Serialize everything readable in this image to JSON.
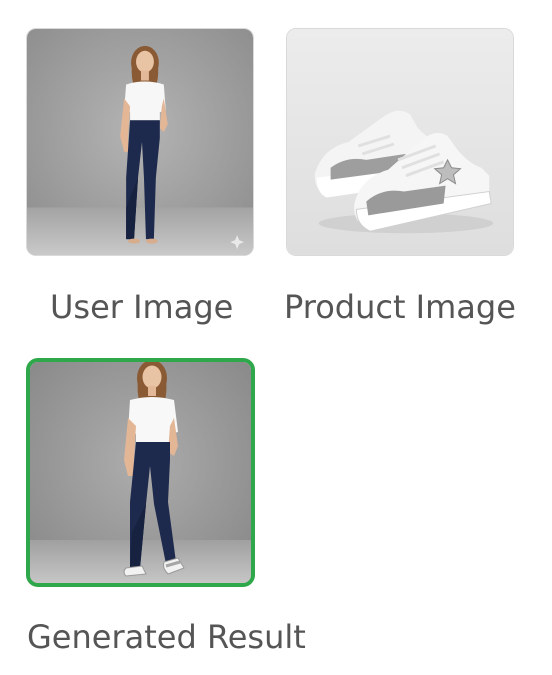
{
  "cards": {
    "user": {
      "label": "User Image"
    },
    "product": {
      "label": "Product Image"
    },
    "result": {
      "label": "Generated Result"
    }
  },
  "colors": {
    "selected_border": "#2ea84a",
    "card_border": "#d9d9d9",
    "label_text": "#555555"
  }
}
